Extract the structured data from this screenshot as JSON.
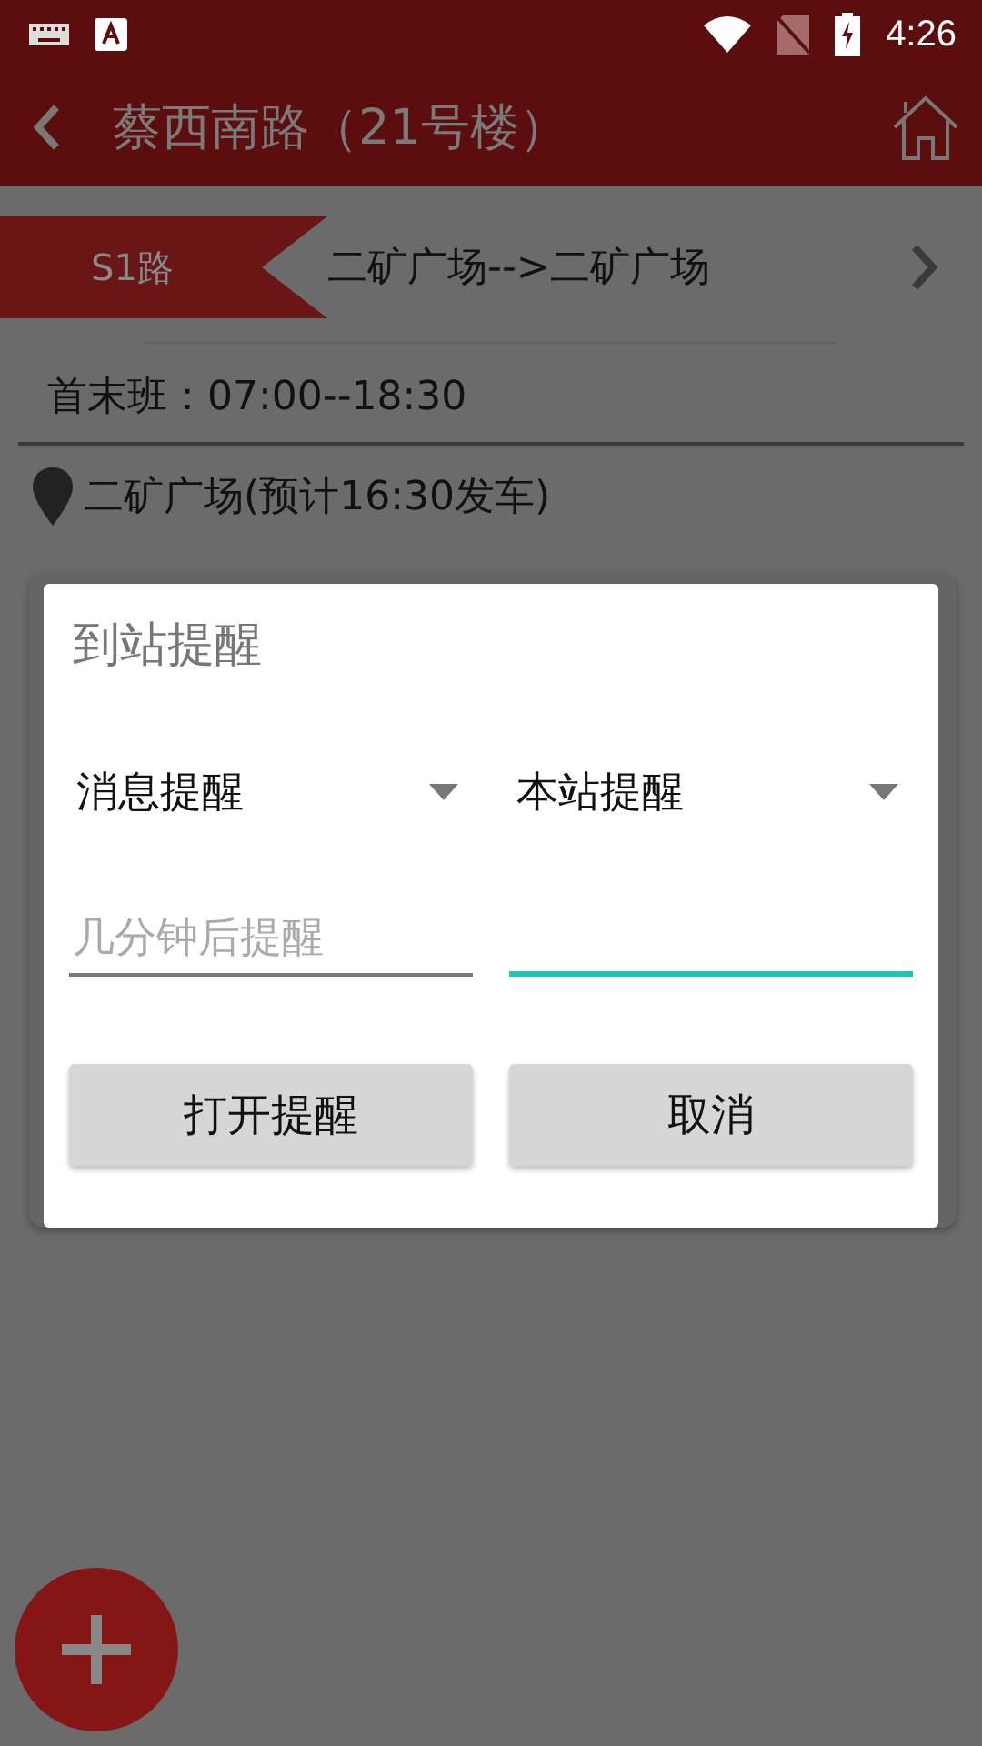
{
  "status_bar": {
    "time": "4:26"
  },
  "app_bar": {
    "title": "蔡西南路（21号楼）"
  },
  "route": {
    "badge": "S1路",
    "direction": "二矿广场-->二矿广场"
  },
  "schedule": "首末班：07:00--18:30",
  "station": "二矿广场(预计16:30发车)",
  "dialog": {
    "title": "到站提醒",
    "dropdowns": [
      {
        "value": "消息提醒"
      },
      {
        "value": "本站提醒"
      }
    ],
    "fields": [
      {
        "placeholder": "几分钟后提醒",
        "focused": false
      },
      {
        "focused": true
      }
    ],
    "buttons": [
      "打开提醒",
      "取消"
    ]
  }
}
